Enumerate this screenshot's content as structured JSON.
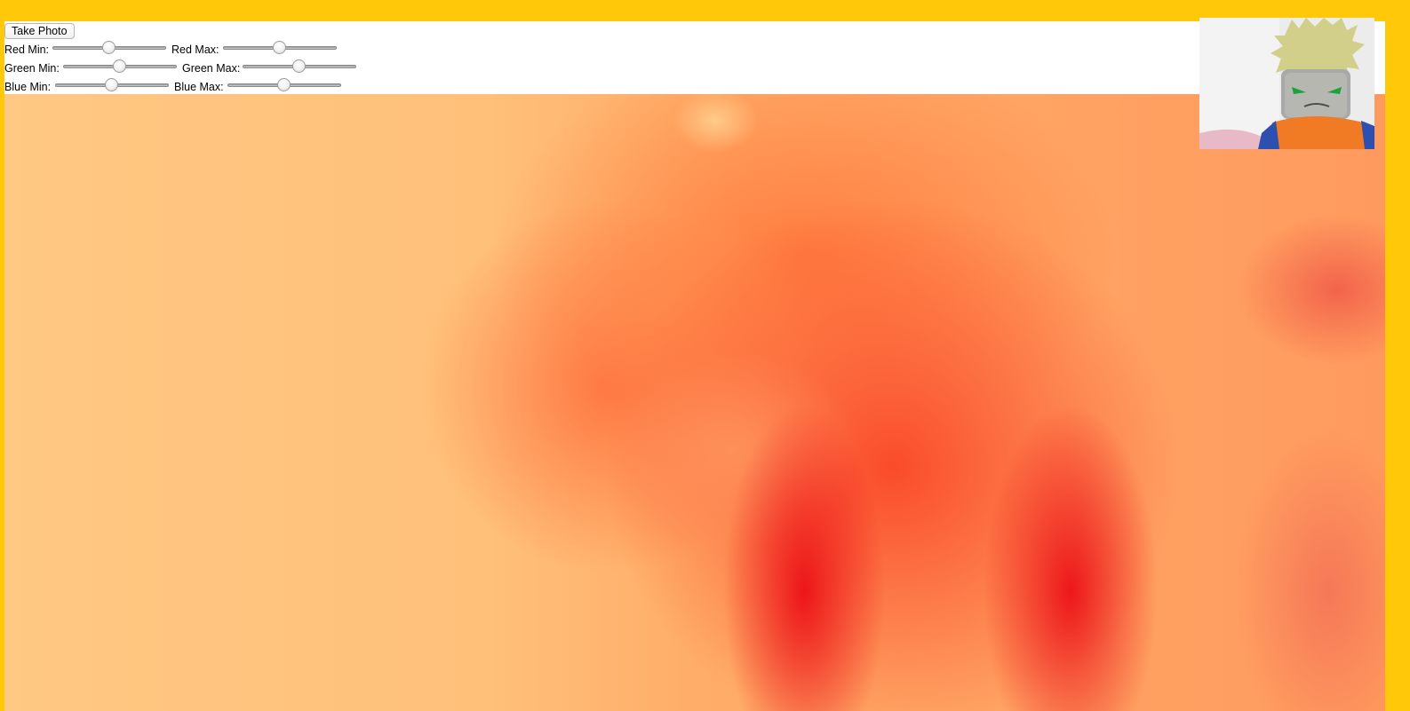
{
  "toolbar": {
    "take_photo_label": "Take Photo"
  },
  "filters": {
    "red_min": {
      "label": "Red Min:",
      "value": 0.5
    },
    "red_max": {
      "label": "Red Max:",
      "value": 0.5
    },
    "green_min": {
      "label": "Green Min:",
      "value": 0.5
    },
    "green_max": {
      "label": "Green Max:",
      "value": 0.5
    },
    "blue_min": {
      "label": "Blue Min:",
      "value": 0.5
    },
    "blue_max": {
      "label": "Blue Max:",
      "value": 0.5
    }
  },
  "colors": {
    "page_background": "#ffc808",
    "controls_background": "#ffffff"
  }
}
